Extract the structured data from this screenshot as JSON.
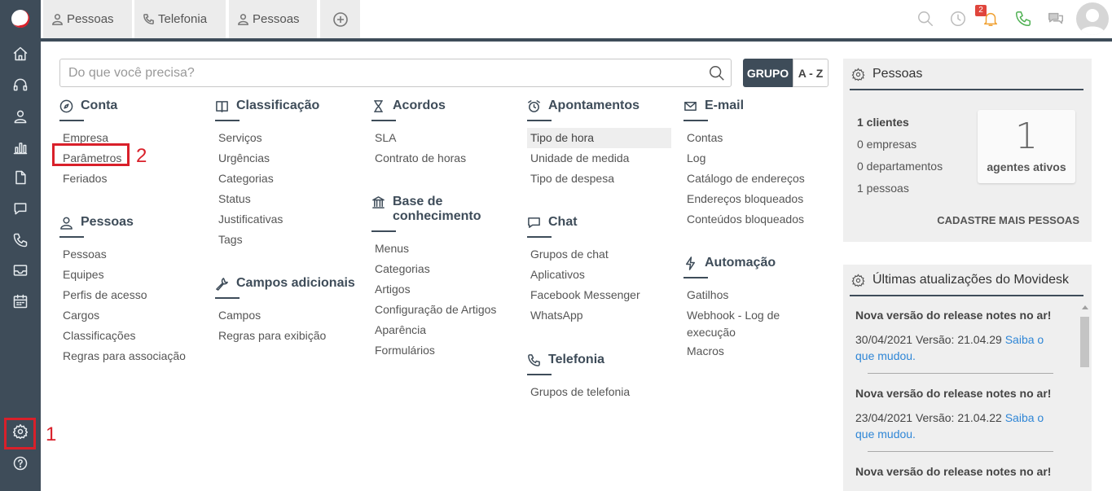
{
  "top_tabs": [
    {
      "label": "Pessoas",
      "icon": "person-icon"
    },
    {
      "label": "Telefonia",
      "icon": "phone-icon"
    },
    {
      "label": "Pessoas",
      "icon": "person-icon"
    }
  ],
  "notifications": {
    "count": "2"
  },
  "search": {
    "placeholder": "Do que você precisa?"
  },
  "view_toggle": {
    "group": "GRUPO",
    "az": "A - Z"
  },
  "annotations": {
    "one": "1",
    "two": "2"
  },
  "sections": {
    "conta": {
      "title": "Conta",
      "items": [
        "Empresa",
        "Parâmetros",
        "Feriados"
      ]
    },
    "pessoas": {
      "title": "Pessoas",
      "items": [
        "Pessoas",
        "Equipes",
        "Perfis de acesso",
        "Cargos",
        "Classificações",
        "Regras para associação"
      ]
    },
    "classificacao": {
      "title": "Classificação",
      "items": [
        "Serviços",
        "Urgências",
        "Categorias",
        "Status",
        "Justificativas",
        "Tags"
      ]
    },
    "campos": {
      "title": "Campos adicionais",
      "items": [
        "Campos",
        "Regras para exibição"
      ]
    },
    "acordos": {
      "title": "Acordos",
      "items": [
        "SLA",
        "Contrato de horas"
      ]
    },
    "base": {
      "title_line1": "Base de",
      "title_line2": "conhecimento",
      "items": [
        "Menus",
        "Categorias",
        "Artigos",
        "Configuração de Artigos",
        "Aparência",
        "Formulários"
      ]
    },
    "apontamentos": {
      "title": "Apontamentos",
      "items": [
        "Tipo de hora",
        "Unidade de medida",
        "Tipo de despesa"
      ]
    },
    "chat": {
      "title": "Chat",
      "items": [
        "Grupos de chat",
        "Aplicativos",
        "Facebook Messenger",
        "WhatsApp"
      ]
    },
    "telefonia": {
      "title": "Telefonia",
      "items": [
        "Grupos de telefonia"
      ]
    },
    "email": {
      "title": "E-mail",
      "items": [
        "Contas",
        "Log",
        "Catálogo de endereços",
        "Endereços bloqueados",
        "Conteúdos bloqueados"
      ]
    },
    "automacao": {
      "title": "Automação",
      "items": [
        "Gatilhos",
        "Webhook - Log de",
        "execução",
        "Macros"
      ]
    }
  },
  "pessoas_panel": {
    "title": "Pessoas",
    "clientes": "1 clientes",
    "empresas": "0 empresas",
    "departamentos": "0 departamentos",
    "pessoas": "1 pessoas",
    "agentes_num": "1",
    "agentes_label": "agentes ativos",
    "cta": "CADASTRE MAIS PESSOAS"
  },
  "updates_panel": {
    "title": "Últimas atualizações do Movidesk",
    "entries": [
      {
        "title": "Nova versão do release notes no ar!",
        "meta": "30/04/2021 Versão: 21.04.29 ",
        "link_a": "Saiba o",
        "link_b": "que mudou."
      },
      {
        "title": "Nova versão do release notes no ar!",
        "meta": "23/04/2021 Versão: 21.04.22 ",
        "link_a": "Saiba o",
        "link_b": "que mudou."
      },
      {
        "title": "Nova versão do release notes no ar!"
      }
    ]
  }
}
